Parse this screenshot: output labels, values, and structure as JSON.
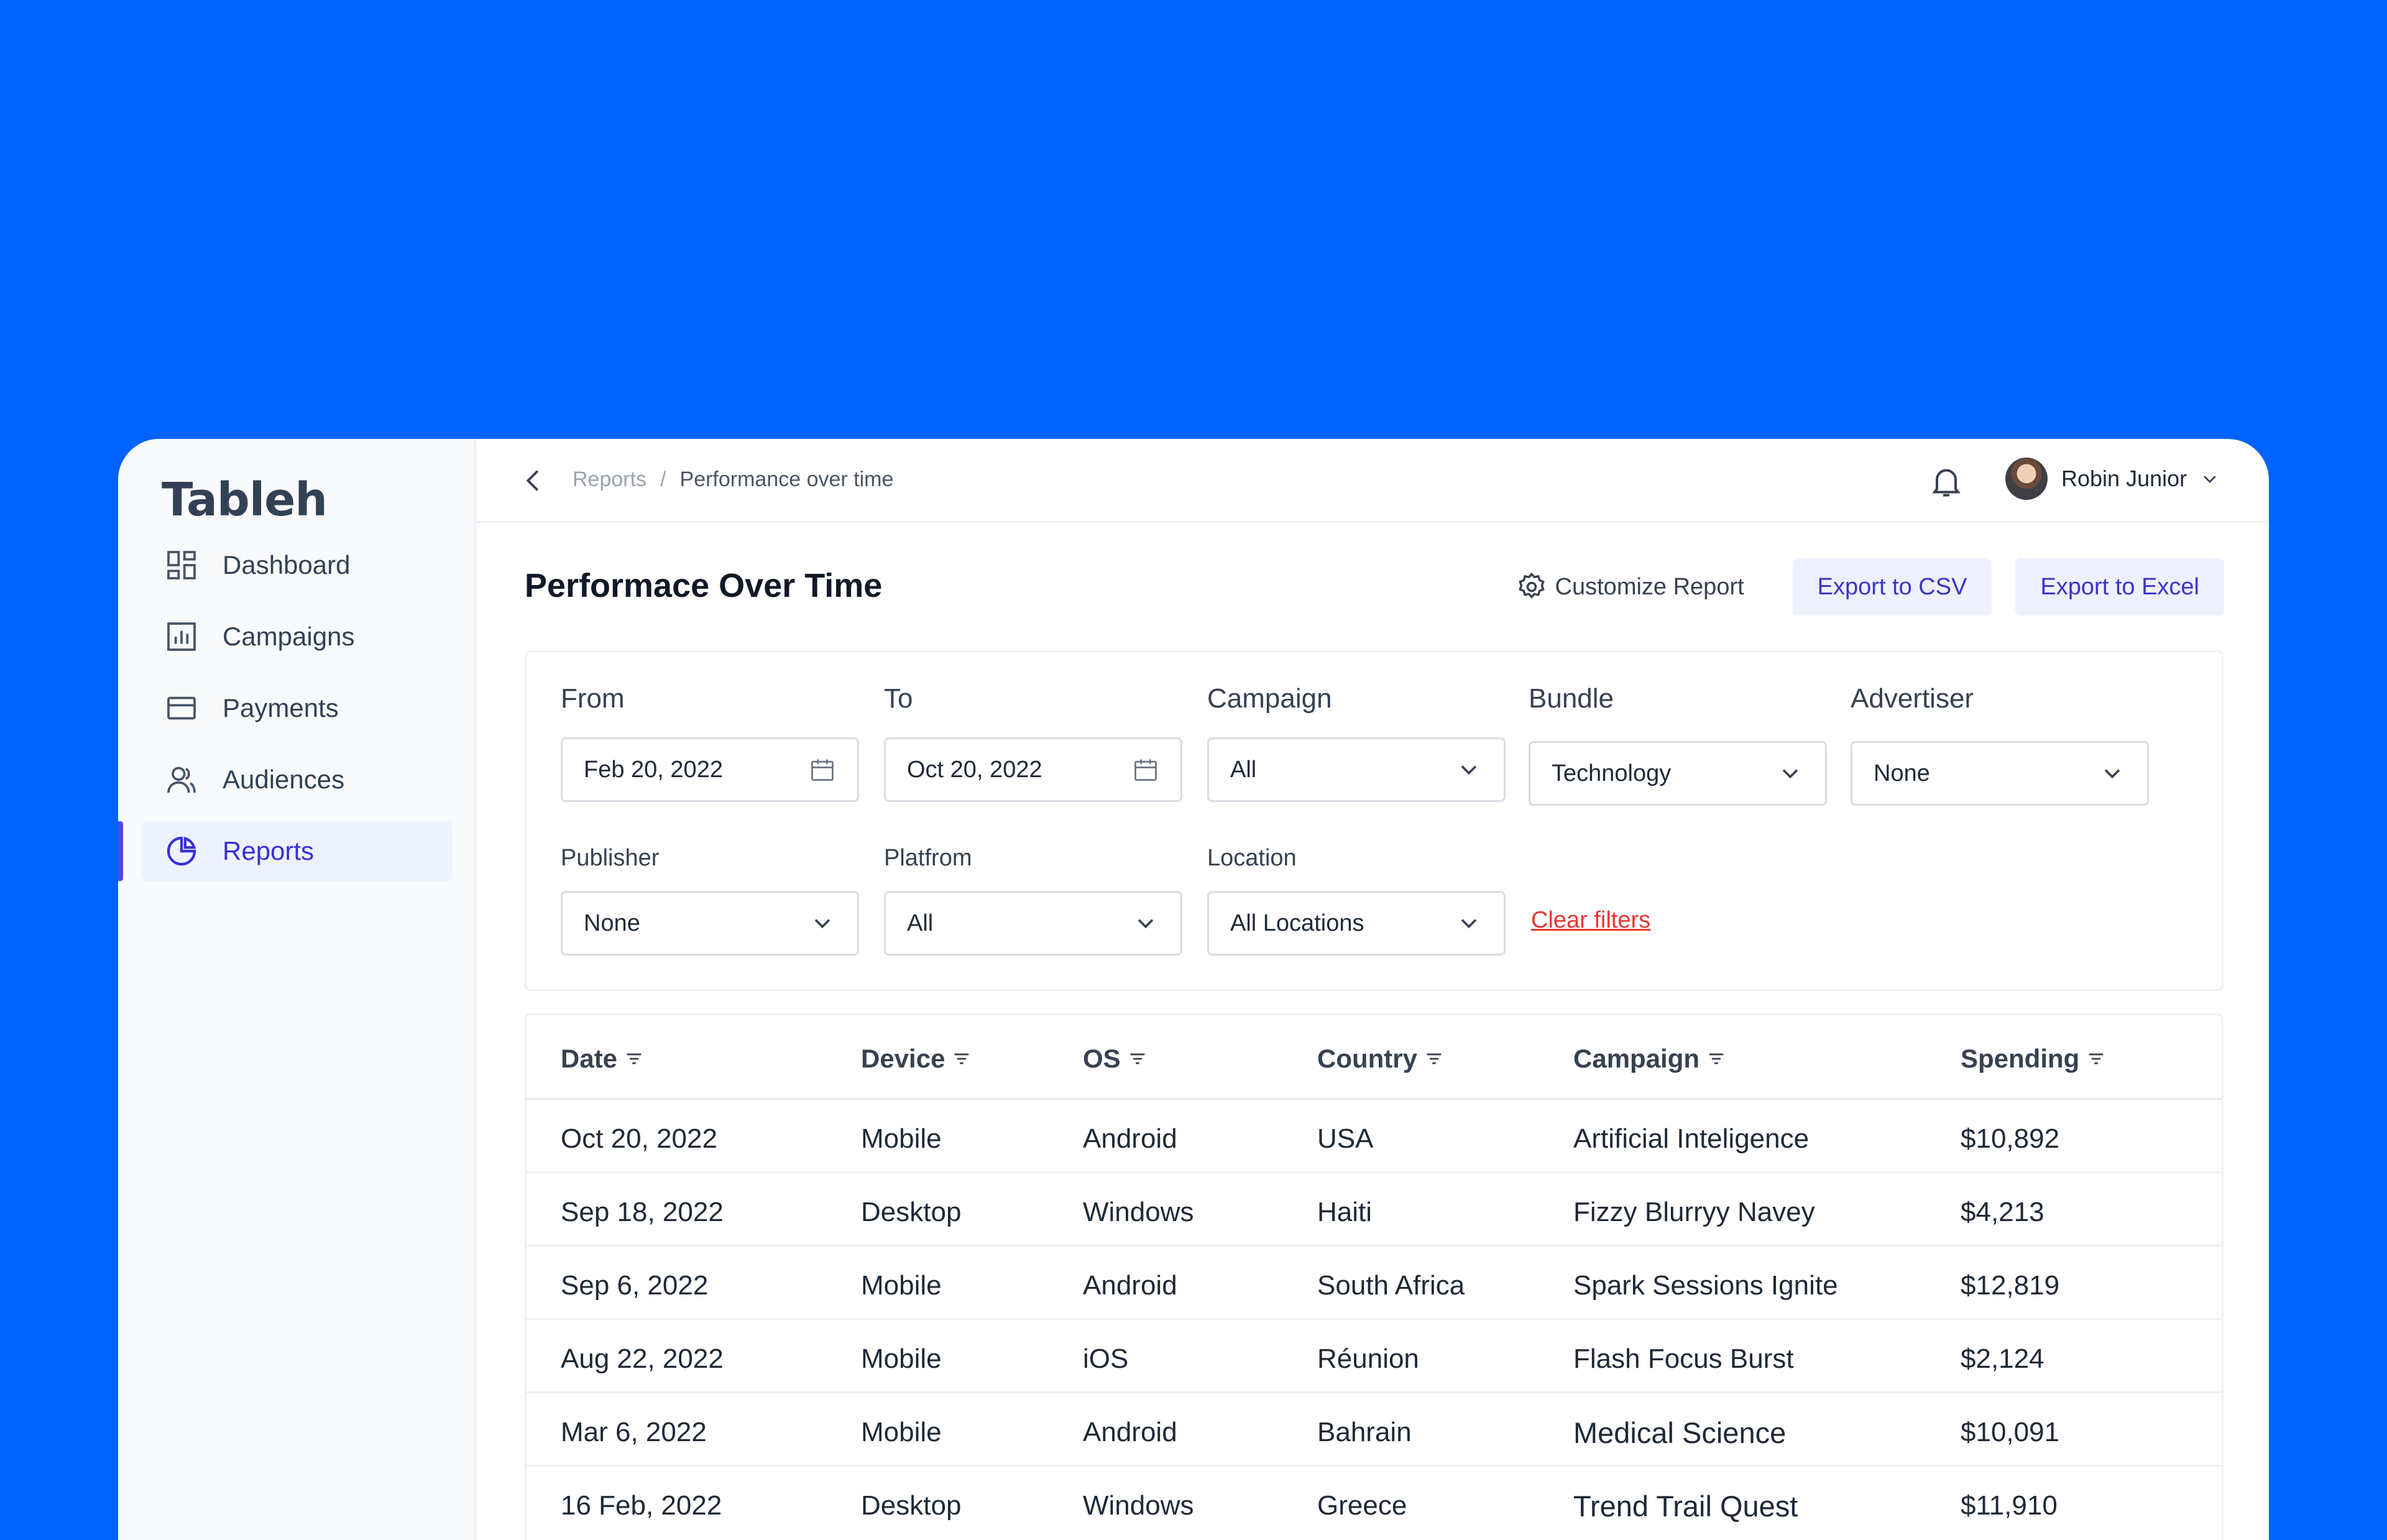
{
  "brand": "Tableh",
  "nav": [
    {
      "label": "Dashboard",
      "icon": "grid-icon"
    },
    {
      "label": "Campaigns",
      "icon": "bar-chart-icon"
    },
    {
      "label": "Payments",
      "icon": "card-icon"
    },
    {
      "label": "Audiences",
      "icon": "users-icon"
    },
    {
      "label": "Reports",
      "icon": "pie-chart-icon"
    }
  ],
  "breadcrumb": {
    "root": "Reports",
    "separator": "/",
    "current": "Performance over time"
  },
  "user": {
    "name": "Robin Junior"
  },
  "page": {
    "title": "Performace Over Time",
    "customize_label": "Customize Report",
    "export_csv_label": "Export to CSV",
    "export_excel_label": "Export to Excel"
  },
  "filters": {
    "from": {
      "label": "From",
      "value": "Feb 20, 2022"
    },
    "to": {
      "label": "To",
      "value": "Oct 20, 2022"
    },
    "campaign": {
      "label": "Campaign",
      "value": "All"
    },
    "bundle": {
      "label": "Bundle",
      "value": "Technology"
    },
    "advertiser": {
      "label": "Advertiser",
      "value": "None"
    },
    "publisher": {
      "label": "Publisher",
      "value": "None"
    },
    "platform": {
      "label": "Platfrom",
      "value": "All"
    },
    "location": {
      "label": "Location",
      "value": "All Locations"
    },
    "clear_label": "Clear filters"
  },
  "table": {
    "columns": [
      "Date",
      "Device",
      "OS",
      "Country",
      "Campaign",
      "Spending"
    ],
    "rows": [
      [
        "Oct 20, 2022",
        "Mobile",
        "Android",
        "USA",
        "Artificial Inteligence",
        "$10,892"
      ],
      [
        "Sep 18, 2022",
        "Desktop",
        "Windows",
        "Haiti",
        "Fizzy Blurryy Navey",
        "$4,213"
      ],
      [
        "Sep 6, 2022",
        "Mobile",
        "Android",
        "South Africa",
        "Spark Sessions Ignite",
        "$12,819"
      ],
      [
        "Aug 22, 2022",
        "Mobile",
        "iOS",
        "Réunion",
        "Flash Focus Burst",
        "$2,124"
      ],
      [
        "Mar 6, 2022",
        "Mobile",
        "Android",
        "Bahrain",
        "Medical Science",
        "$10,091"
      ],
      [
        "16 Feb, 2022",
        "Desktop",
        "Windows",
        "Greece",
        "Trend Trail Quest",
        "$11,910"
      ]
    ]
  },
  "colors": {
    "background": "#0163FE",
    "accent": "#3730D9",
    "danger": "#E53935"
  }
}
